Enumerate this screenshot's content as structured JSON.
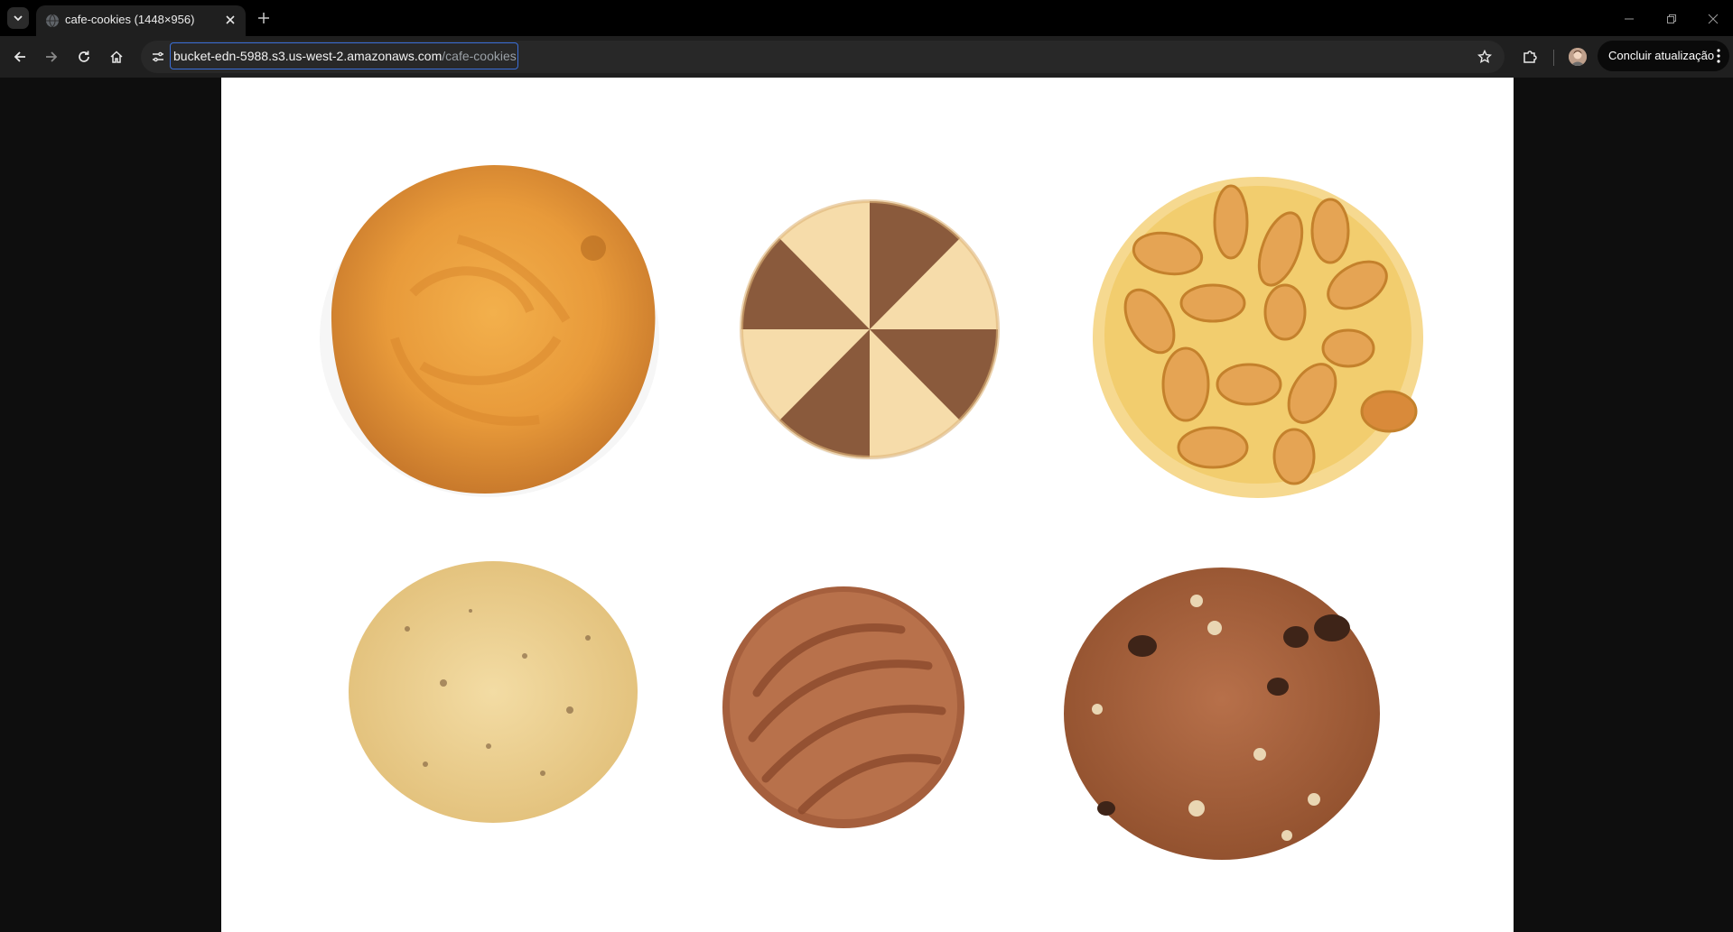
{
  "browser": {
    "tab": {
      "title": "cafe-cookies (1448×956)"
    },
    "omnibox": {
      "url_host": "bucket-edn-5988.s3.us-west-2.amazonaws.com",
      "url_path": "/cafe-cookies"
    },
    "update_button": {
      "label": "Concluir atualização"
    },
    "icons": [
      "tab-search-icon",
      "globe-icon",
      "close-icon",
      "plus-icon",
      "back-icon",
      "forward-icon",
      "reload-icon",
      "home-icon",
      "site-settings-icon",
      "star-icon",
      "extensions-icon",
      "avatar",
      "more-icon",
      "minimize-icon",
      "restore-icon",
      "close-window-icon"
    ]
  },
  "image": {
    "cookies": [
      "butter-cookie",
      "striped-shortbread-cookie",
      "peanut-cookie",
      "oat-cookie",
      "chocolate-coated-cookie",
      "chocolate-chip-cookie"
    ]
  }
}
